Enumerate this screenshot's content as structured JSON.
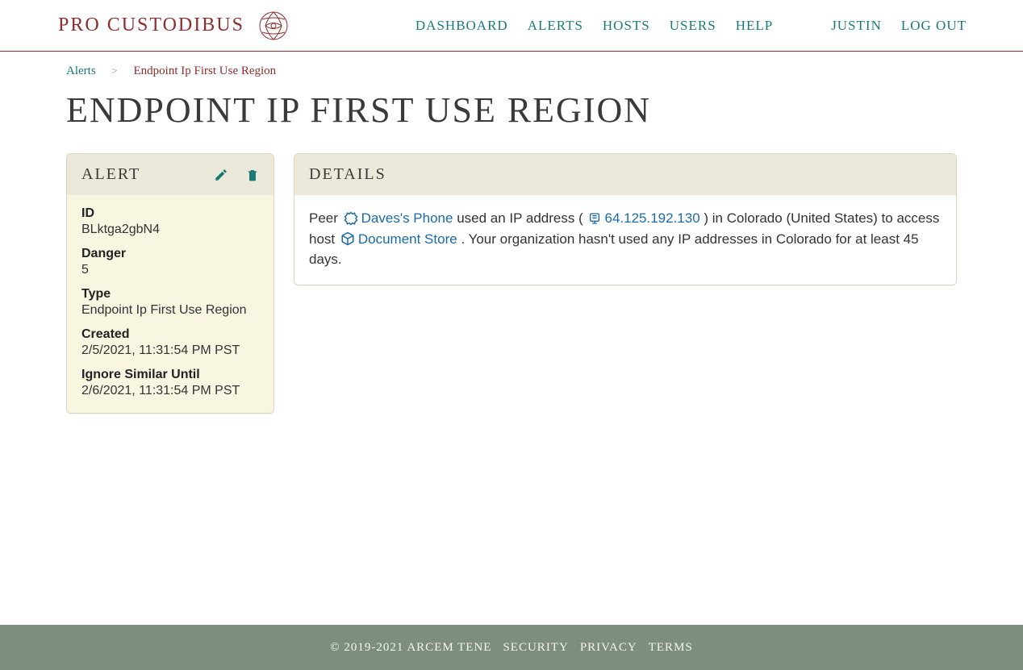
{
  "brand": {
    "name": "PRO CUSTODIBUS"
  },
  "nav": {
    "dashboard": "DASHBOARD",
    "alerts": "ALERTS",
    "hosts": "HOSTS",
    "users": "USERS",
    "help": "HELP",
    "username": "JUSTIN",
    "logout": "LOG OUT"
  },
  "breadcrumbs": {
    "alerts": "Alerts",
    "current": "Endpoint Ip First Use Region"
  },
  "page": {
    "title": "ENDPOINT IP FIRST USE REGION"
  },
  "alert_card": {
    "title": "ALERT",
    "fields": {
      "id_label": "ID",
      "id_value": "BLktga2gbN4",
      "danger_label": "Danger",
      "danger_value": "5",
      "type_label": "Type",
      "type_value": "Endpoint Ip First Use Region",
      "created_label": "Created",
      "created_value": "2/5/2021, 11:31:54 PM PST",
      "ignore_label": "Ignore Similar Until",
      "ignore_value": "2/6/2021, 11:31:54 PM PST"
    }
  },
  "details_card": {
    "title": "DETAILS",
    "text": {
      "t1": "Peer ",
      "peer_name": "Daves's Phone",
      "t2": " used an IP address ( ",
      "ip": "64.125.192.130",
      "t3": " ) in Colorado (United States) to access host ",
      "host_name": "Document Store",
      "t4": " . Your organization hasn't used any IP addresses in Colorado for at least 45 days."
    }
  },
  "footer": {
    "copyright": "© 2019-2021 ARCEM TENE",
    "security": "SECURITY",
    "privacy": "PRIVACY",
    "terms": "TERMS"
  }
}
